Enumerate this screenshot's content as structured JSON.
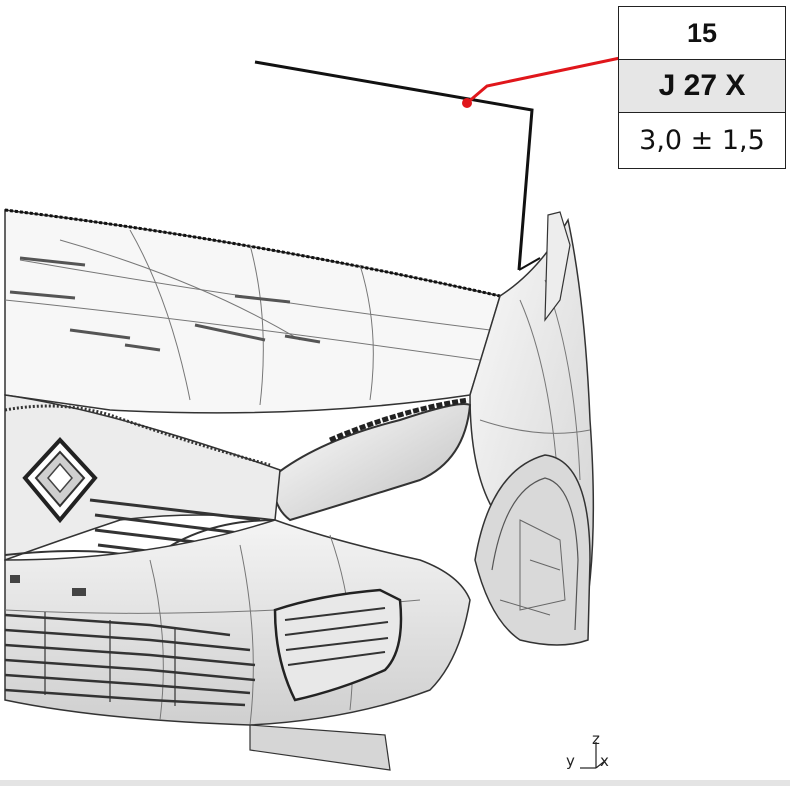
{
  "callout": {
    "number": "15",
    "code": "J 27 X",
    "tolerance": "3,0 ± 1,5"
  },
  "axis": {
    "y_label": "y",
    "z_label": "z",
    "x_label": "x"
  },
  "colors": {
    "leader_line": "#e0161b",
    "measure_line": "#111111",
    "highlight_row": "#e6e6e6"
  },
  "icons": [
    "renault-logo-icon",
    "axis-triad-icon"
  ]
}
